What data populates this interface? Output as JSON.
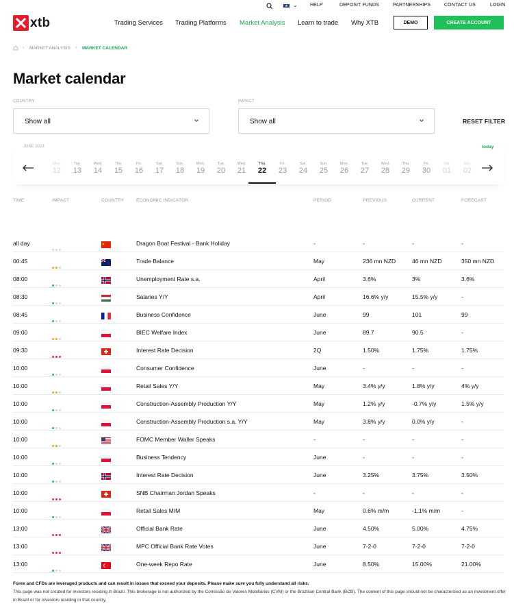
{
  "util_links": [
    "HELP",
    "DEPOSIT FUNDS",
    "PARTNERSHIPS",
    "CONTACT US",
    "LOGIN"
  ],
  "logo_text": "xtb",
  "nav": [
    "Trading Services",
    "Trading Platforms",
    "Market Analysis",
    "Learn to trade",
    "Why XTB"
  ],
  "buttons": {
    "demo": "DEMO",
    "create": "CREATE ACCOUNT"
  },
  "breadcrumb": [
    "MARKET ANALYSIS",
    "MARKET CALENDAR"
  ],
  "title": "Market calendar",
  "filters": {
    "country_label": "COUNTRY",
    "country_value": "Show all",
    "impact_label": "IMPACT",
    "impact_value": "Show all",
    "reset": "RESET FILTER"
  },
  "strip": {
    "month": "JUNE 2023",
    "today": "today",
    "days": [
      {
        "n": "Mon.",
        "d": "12"
      },
      {
        "n": "Tue.",
        "d": "13"
      },
      {
        "n": "Wed.",
        "d": "14"
      },
      {
        "n": "Thu.",
        "d": "15"
      },
      {
        "n": "Fri.",
        "d": "16"
      },
      {
        "n": "Sat.",
        "d": "17"
      },
      {
        "n": "Sun.",
        "d": "18"
      },
      {
        "n": "Mon.",
        "d": "19"
      },
      {
        "n": "Tue.",
        "d": "20"
      },
      {
        "n": "Wed.",
        "d": "21"
      },
      {
        "n": "Thu.",
        "d": "22"
      },
      {
        "n": "Fri.",
        "d": "23"
      },
      {
        "n": "Sat.",
        "d": "24"
      },
      {
        "n": "Sun.",
        "d": "25"
      },
      {
        "n": "Mon.",
        "d": "26"
      },
      {
        "n": "Tue.",
        "d": "27"
      },
      {
        "n": "Wed.",
        "d": "28"
      },
      {
        "n": "Thu.",
        "d": "29"
      },
      {
        "n": "Fri.",
        "d": "30"
      },
      {
        "n": "Sat.",
        "d": "01"
      },
      {
        "n": "Sun.",
        "d": "02"
      }
    ],
    "selected": "22"
  },
  "columns": [
    "TIME",
    "IMPACT",
    "COUNTRY",
    "ECONOMIC INDICATOR",
    "PERIOD",
    "PREVIOUS",
    "CURRENT",
    "FORECAST"
  ],
  "impact_colors": {
    "low": "#1fbf5a",
    "medium": "#f2a71b",
    "high": "#e0313d",
    "off": "#d5d5d5"
  },
  "rows": [
    {
      "time": "all day",
      "impact": "none",
      "flag": "CN",
      "indicator": "Dragon Boat Festival - Bank Holiday",
      "period": "-",
      "previous": "-",
      "current": "-",
      "forecast": "-"
    },
    {
      "time": "00:45",
      "impact": "medium",
      "flag": "NZ",
      "indicator": "Trade Balance",
      "period": "May",
      "previous": "236 mn NZD",
      "current": "46 mn NZD",
      "forecast": "350 mn NZD"
    },
    {
      "time": "08:00",
      "impact": "low",
      "flag": "NO",
      "indicator": "Unemployment Rate s.a.",
      "period": "April",
      "previous": "3.6%",
      "current": "3%",
      "forecast": "3.6%"
    },
    {
      "time": "08:30",
      "impact": "low",
      "flag": "HU",
      "indicator": "Salaries Y/Y",
      "period": "April",
      "previous": "16.6% y/y",
      "current": "15.5% y/y",
      "forecast": "-"
    },
    {
      "time": "08:45",
      "impact": "low",
      "flag": "FR",
      "indicator": "Business Confidence",
      "period": "June",
      "previous": "99",
      "current": "101",
      "forecast": "99"
    },
    {
      "time": "09:00",
      "impact": "medium",
      "flag": "PL",
      "indicator": "BIEC Welfare Index",
      "period": "June",
      "previous": "89.7",
      "current": "90.5",
      "forecast": "-"
    },
    {
      "time": "09:30",
      "impact": "high",
      "flag": "CH",
      "indicator": "Interest Rate Decision",
      "period": "2Q",
      "previous": "1.50%",
      "current": "1.75%",
      "forecast": "1.75%"
    },
    {
      "time": "10:00",
      "impact": "low",
      "flag": "PL",
      "indicator": "Consumer Confidence",
      "period": "June",
      "previous": "-",
      "current": "-",
      "forecast": "-"
    },
    {
      "time": "10:00",
      "impact": "medium",
      "flag": "PL",
      "indicator": "Retail Sales Y/Y",
      "period": "May",
      "previous": "3.4% y/y",
      "current": "1.8% y/y",
      "forecast": "4% y/y"
    },
    {
      "time": "10:00",
      "impact": "low",
      "flag": "PL",
      "indicator": "Construction-Assembly Production Y/Y",
      "period": "May",
      "previous": "1.2% y/y",
      "current": "-0.7% y/y",
      "forecast": "1.5% y/y"
    },
    {
      "time": "10:00",
      "impact": "low",
      "flag": "PL",
      "indicator": "Construction-Assembly Production s.a. Y/Y",
      "period": "May",
      "previous": "3.8% y/y",
      "current": "0.0% y/y",
      "forecast": "-"
    },
    {
      "time": "10:00",
      "impact": "medium",
      "flag": "US",
      "indicator": "FOMC Member Waller Speaks",
      "period": "-",
      "previous": "-",
      "current": "-",
      "forecast": "-"
    },
    {
      "time": "10:00",
      "impact": "low",
      "flag": "PL",
      "indicator": "Business Tendency",
      "period": "June",
      "previous": "-",
      "current": "-",
      "forecast": "-"
    },
    {
      "time": "10:00",
      "impact": "low",
      "flag": "NO",
      "indicator": "Interest Rate Decision",
      "period": "June",
      "previous": "3.25%",
      "current": "3.75%",
      "forecast": "3.50%"
    },
    {
      "time": "10:00",
      "impact": "high",
      "flag": "CH",
      "indicator": "SNB Chairman Jordan Speaks",
      "period": "-",
      "previous": "-",
      "current": "-",
      "forecast": "-"
    },
    {
      "time": "10:00",
      "impact": "low",
      "flag": "PL",
      "indicator": "Retail Sales M/M",
      "period": "May",
      "previous": "0.6% m/m",
      "current": "-1.1% m/m",
      "forecast": "-"
    },
    {
      "time": "13:00",
      "impact": "high",
      "flag": "GB",
      "indicator": "Official Bank Rate",
      "period": "June",
      "previous": "4.50%",
      "current": "5.00%",
      "forecast": "4.75%"
    },
    {
      "time": "13:00",
      "impact": "high",
      "flag": "GB",
      "indicator": "MPC Official Bank Rate Votes",
      "period": "June",
      "previous": "7-2-0",
      "current": "7-2-0",
      "forecast": "7-2-0"
    },
    {
      "time": "13:00",
      "impact": "low",
      "flag": "TR",
      "indicator": "One-week Repo Rate",
      "period": "June",
      "previous": "8.50%",
      "current": "15.00%",
      "forecast": "21.00%"
    }
  ],
  "disclaimer": {
    "bold": "Forex and CFDs are leveraged products and can result in losses that exceed your deposits. Please make sure you fully understand all risks.",
    "text": "This page was not created for investors residing in Brazil. This brokerage is not authorized by the Comissão de Valores Mobiliários (CVM) or the Brazilian Central Bank (BCB). The content of this page should not be characterized as an investment offer in Brazil or for investors residing in that country."
  }
}
